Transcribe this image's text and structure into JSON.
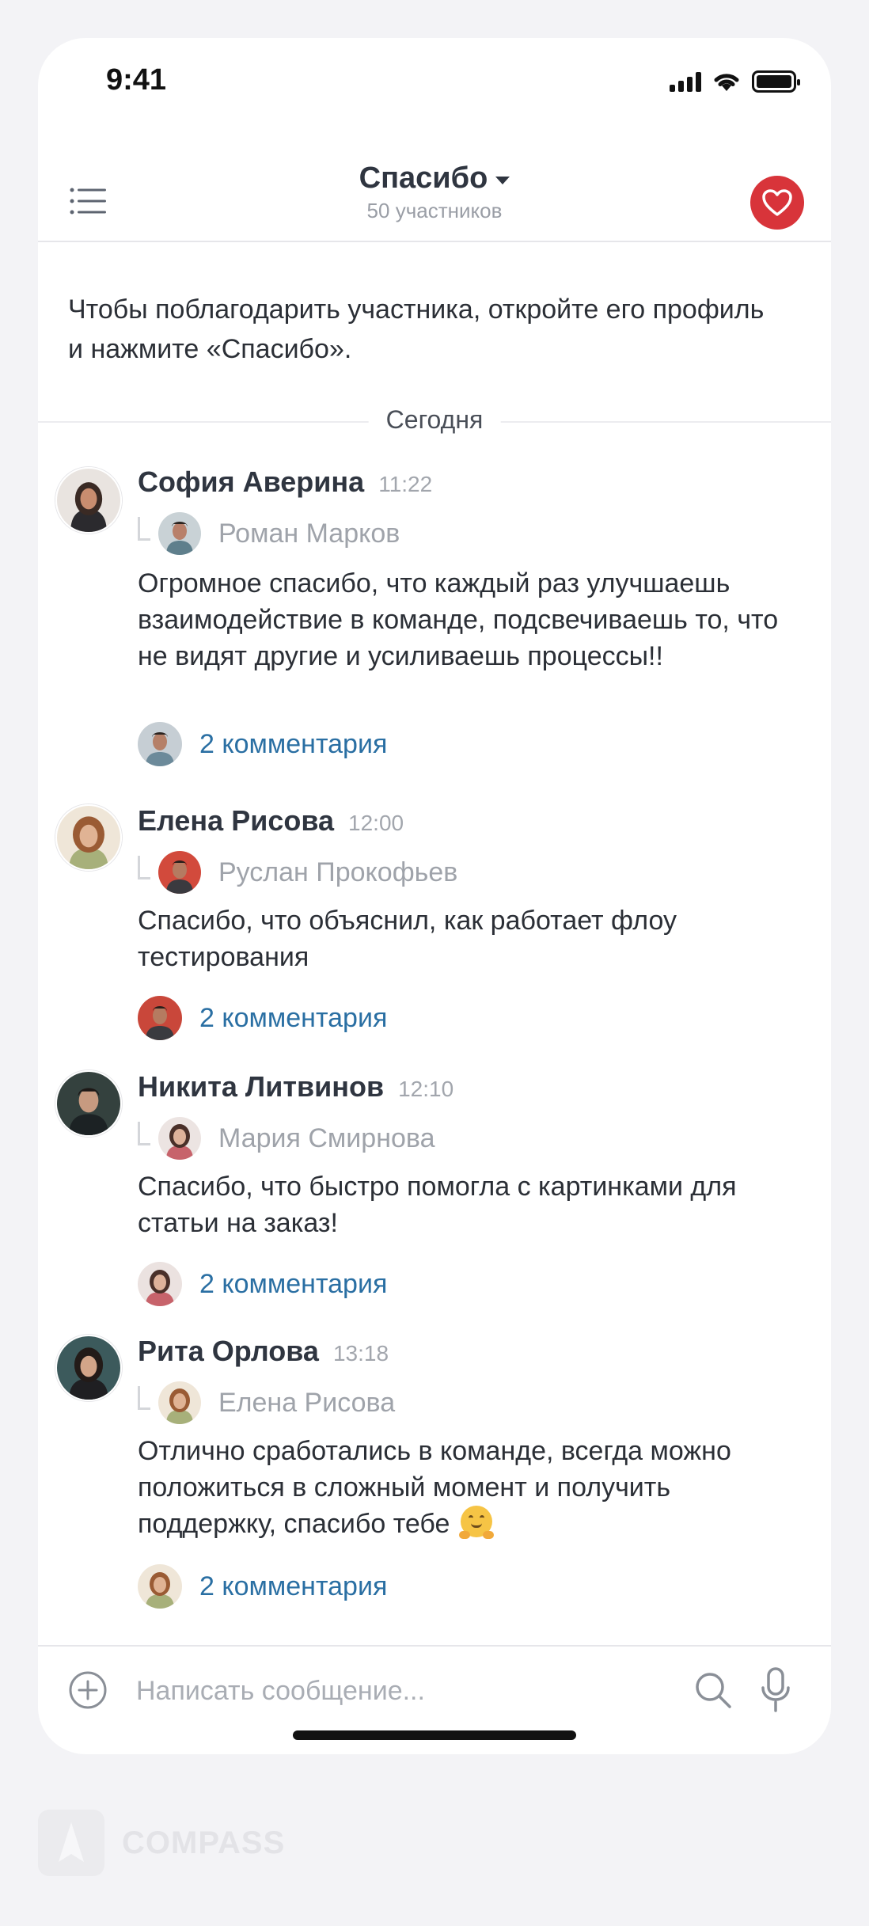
{
  "status_bar": {
    "time": "9:41"
  },
  "header": {
    "title": "Спасибо",
    "subtitle": "50 участников"
  },
  "intro": "Чтобы поблагодарить участника, откройте его профиль и нажмите «Спасибо».",
  "date_separator": "Сегодня",
  "posts": [
    {
      "author": "София Аверина",
      "time": "11:22",
      "recipient": "Роман Марков",
      "message": "Огромное спасибо, что каждый раз улучшаешь взаимодействие в команде, подсвечиваешь то, что не видят другие и усиливаешь процессы!!",
      "comments": "2 комментария"
    },
    {
      "author": "Елена Рисова",
      "time": "12:00",
      "recipient": "Руслан Прокофьев",
      "message": "Спасибо, что объяснил, как работает флоу тестирования",
      "comments": "2 комментария"
    },
    {
      "author": "Никита Литвинов",
      "time": "12:10",
      "recipient": "Мария Смирнова",
      "message": "Спасибо, что быстро помогла с картинками для статьи на заказ!",
      "comments": "2 комментария"
    },
    {
      "author": "Рита Орлова",
      "time": "13:18",
      "recipient": "Елена Рисова",
      "message": "Отлично сработались в команде, всегда можно положиться в сложный момент и получить поддержку, спасибо тебе",
      "message_emoji": "hugging-face",
      "comments": "2 комментария"
    }
  ],
  "composer": {
    "placeholder": "Написать сообщение..."
  },
  "watermark": {
    "brand": "COMPASS"
  },
  "colors": {
    "accent": "#d8343a",
    "link": "#2a6fa3",
    "muted": "#9fa3aa"
  },
  "icons": [
    "menu-icon",
    "chevron-down-icon",
    "heart-icon",
    "plus-icon",
    "search-icon",
    "microphone-icon",
    "signal-icon",
    "wifi-icon",
    "battery-icon"
  ]
}
